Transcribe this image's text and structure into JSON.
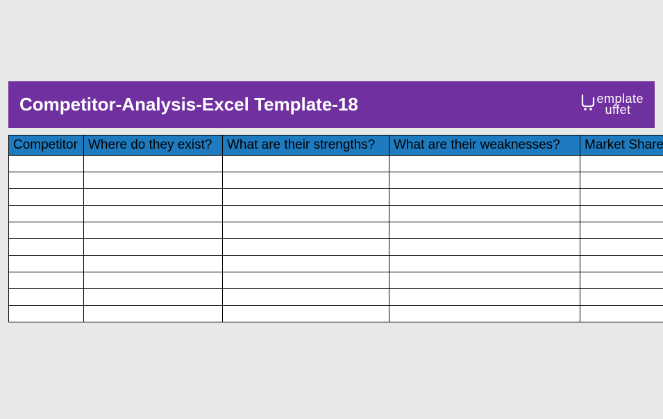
{
  "header": {
    "title": "Competitor-Analysis-Excel Template-18",
    "logo_line1": "emplate",
    "logo_line2": "uffet"
  },
  "table": {
    "columns": [
      "Competitor",
      "Where do they exist?",
      "What are their strengths?",
      "What are their weaknesses?",
      "Market Share"
    ],
    "rows": [
      [
        "",
        "",
        "",
        "",
        ""
      ],
      [
        "",
        "",
        "",
        "",
        ""
      ],
      [
        "",
        "",
        "",
        "",
        ""
      ],
      [
        "",
        "",
        "",
        "",
        ""
      ],
      [
        "",
        "",
        "",
        "",
        ""
      ],
      [
        "",
        "",
        "",
        "",
        ""
      ],
      [
        "",
        "",
        "",
        "",
        ""
      ],
      [
        "",
        "",
        "",
        "",
        ""
      ],
      [
        "",
        "",
        "",
        "",
        ""
      ],
      [
        "",
        "",
        "",
        "",
        ""
      ]
    ]
  }
}
